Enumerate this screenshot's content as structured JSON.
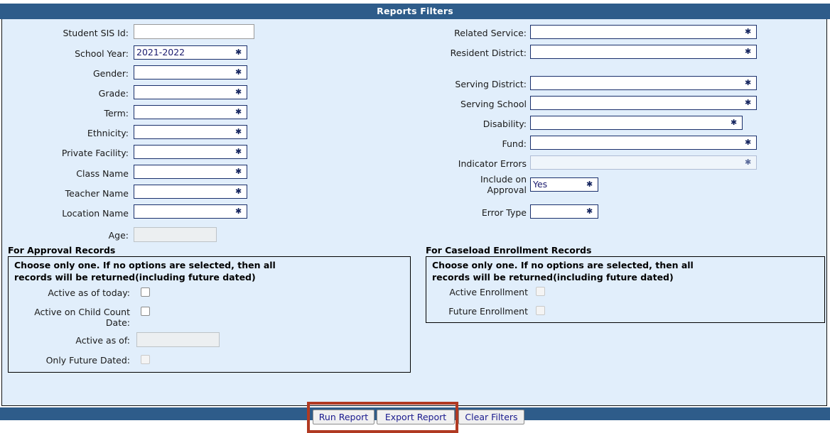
{
  "header": {
    "title": "Reports Filters"
  },
  "left_fields": [
    {
      "label": "Student SIS Id:",
      "type": "text",
      "value": "",
      "disabled": false
    },
    {
      "label": "School Year:",
      "type": "select",
      "value": "2021-2022",
      "disabled": false
    },
    {
      "label": "Gender:",
      "type": "select",
      "value": "",
      "disabled": false
    },
    {
      "label": "Grade:",
      "type": "select",
      "value": "",
      "disabled": false
    },
    {
      "label": "Term:",
      "type": "select",
      "value": "",
      "disabled": false
    },
    {
      "label": "Ethnicity:",
      "type": "select",
      "value": "",
      "disabled": false
    },
    {
      "label": "Private Facility:",
      "type": "select",
      "value": "",
      "disabled": false
    },
    {
      "label": "Class Name",
      "type": "select",
      "value": "",
      "disabled": false
    },
    {
      "label": "Teacher Name",
      "type": "select",
      "value": "",
      "disabled": false
    },
    {
      "label": "Location Name",
      "type": "select",
      "value": "",
      "disabled": false
    },
    {
      "label": "Age:",
      "type": "text",
      "value": "",
      "disabled": true
    }
  ],
  "right_fields": [
    {
      "label": "Related Service:",
      "type": "select",
      "value": "",
      "disabled": false
    },
    {
      "label": "Resident District:",
      "type": "select",
      "value": "",
      "disabled": false
    },
    {
      "label": "Serving District:",
      "type": "select",
      "value": "",
      "disabled": false
    },
    {
      "label": "Serving School",
      "type": "select",
      "value": "",
      "disabled": false
    },
    {
      "label": "Disability:",
      "type": "select",
      "value": "",
      "disabled": false
    },
    {
      "label": "Fund:",
      "type": "select",
      "value": "",
      "disabled": false
    },
    {
      "label": "Indicator Errors",
      "type": "select",
      "value": "",
      "disabled": true
    },
    {
      "label": "Include on\nApproval",
      "type": "select",
      "value": "Yes",
      "disabled": false
    },
    {
      "label": "Error Type",
      "type": "select",
      "value": "",
      "disabled": false
    }
  ],
  "approval_group": {
    "title": "For Approval Records",
    "note": "Choose only one. If no options are selected, then all records will be returned(including future dated)",
    "rows": [
      {
        "label": "Active as of today:",
        "control": "checkbox",
        "checked": false,
        "disabled": false
      },
      {
        "label": "Active on Child Count\nDate:",
        "control": "checkbox",
        "checked": false,
        "disabled": false
      },
      {
        "label": "Active as of:",
        "control": "text",
        "value": "",
        "disabled": true
      },
      {
        "label": "Only Future Dated:",
        "control": "checkbox",
        "checked": false,
        "disabled": true
      }
    ]
  },
  "caseload_group": {
    "title": "For Caseload Enrollment Records",
    "note": "Choose only one. If no options are selected, then all records will be returned(including future dated)",
    "rows": [
      {
        "label": "Active Enrollment",
        "control": "checkbox",
        "checked": false,
        "disabled": true
      },
      {
        "label": "Future Enrollment",
        "control": "checkbox",
        "checked": false,
        "disabled": true
      }
    ]
  },
  "footer": {
    "buttons": [
      {
        "label": "Run Report"
      },
      {
        "label": "Export Report"
      },
      {
        "label": "Clear Filters"
      }
    ]
  },
  "annotation": {
    "type": "red-rectangle-highlight",
    "color": "#b03a22"
  },
  "colors": {
    "title_bar": "#2e5c8a",
    "panel_bg": "#e1eefb",
    "field_text": "#1a1a6e",
    "button_text": "#1a1a8e",
    "highlight": "#b03a22"
  }
}
